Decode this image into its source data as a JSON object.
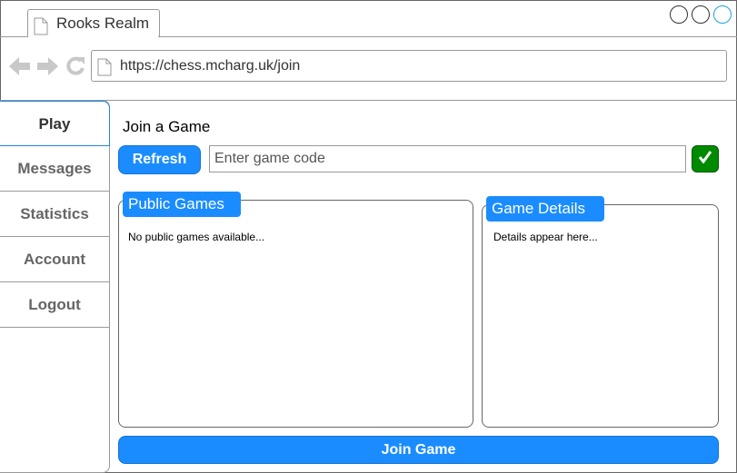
{
  "browser": {
    "tab_title": "Rooks Realm",
    "url": "https://chess.mcharg.uk/join"
  },
  "sidebar": {
    "items": [
      {
        "label": "Play",
        "active": true
      },
      {
        "label": "Messages"
      },
      {
        "label": "Statistics"
      },
      {
        "label": "Account"
      },
      {
        "label": "Logout"
      }
    ]
  },
  "main": {
    "title": "Join a Game",
    "refresh_label": "Refresh",
    "code_placeholder": "Enter game code",
    "public_games": {
      "header": "Public Games",
      "empty_message": "No public games available..."
    },
    "game_details": {
      "header": "Game Details",
      "empty_message": "Details appear here..."
    },
    "join_label": "Join Game"
  },
  "colors": {
    "accent": "#1a8cff",
    "confirm": "#008a00"
  }
}
